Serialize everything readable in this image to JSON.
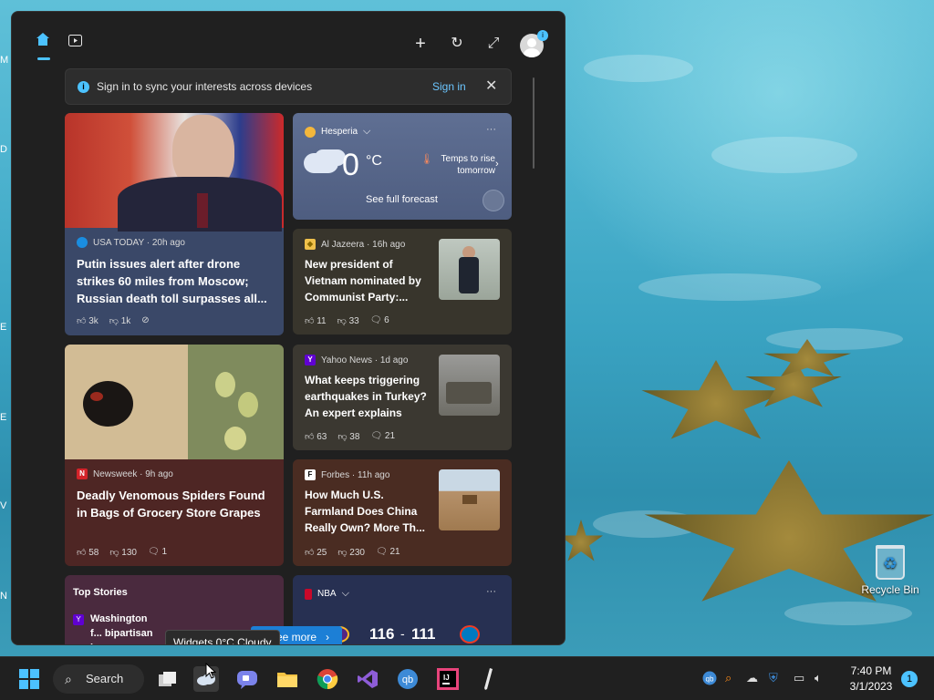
{
  "desktop": {
    "recycle_bin_label": "Recycle Bin",
    "edge_letters": [
      "M",
      "D",
      "E",
      "E",
      "V",
      "N"
    ]
  },
  "widgets": {
    "signin_banner": {
      "message": "Sign in to sync your interests across devices",
      "link": "Sign in"
    },
    "weather": {
      "location": "Hesperia",
      "temp": "0",
      "unit": "°C",
      "alert": "Temps to rise tomorrow",
      "forecast_link": "See full forecast",
      "more": "···"
    },
    "news": [
      {
        "source": "USA TODAY · 20h ago",
        "headline": "Putin issues alert after drone strikes 60 miles from Moscow; Russian death toll surpasses all...",
        "likes": "3k",
        "dislikes": "1k"
      },
      {
        "source": "Al Jazeera · 16h ago",
        "headline": "New president of Vietnam nominated by Communist Party:...",
        "likes": "11",
        "dislikes": "33",
        "comments": "6"
      },
      {
        "source": "Yahoo News · 1d ago",
        "headline": "What keeps triggering earthquakes in Turkey? An expert explains",
        "likes": "63",
        "dislikes": "38",
        "comments": "21"
      },
      {
        "source": "Newsweek · 9h ago",
        "headline": "Deadly Venomous Spiders Found in Bags of Grocery Store Grapes",
        "likes": "58",
        "dislikes": "130",
        "comments": "1"
      },
      {
        "source": "Forbes · 11h ago",
        "headline": "How Much U.S. Farmland Does China Really Own? More Th...",
        "likes": "25",
        "dislikes": "230",
        "comments": "21"
      }
    ],
    "top_stories": {
      "title": "Top Stories",
      "item": "Washington f... bipartisan iss..."
    },
    "nba": {
      "label": "NBA",
      "score_home": "116",
      "score_sep": "-",
      "score_away": "111",
      "more": "···"
    },
    "tooltip": "Widgets 0°C Cloudy",
    "see_more": "ee more"
  },
  "taskbar": {
    "search_label": "Search",
    "time": "7:40 PM",
    "date": "3/1/2023",
    "notification_count": "1"
  }
}
